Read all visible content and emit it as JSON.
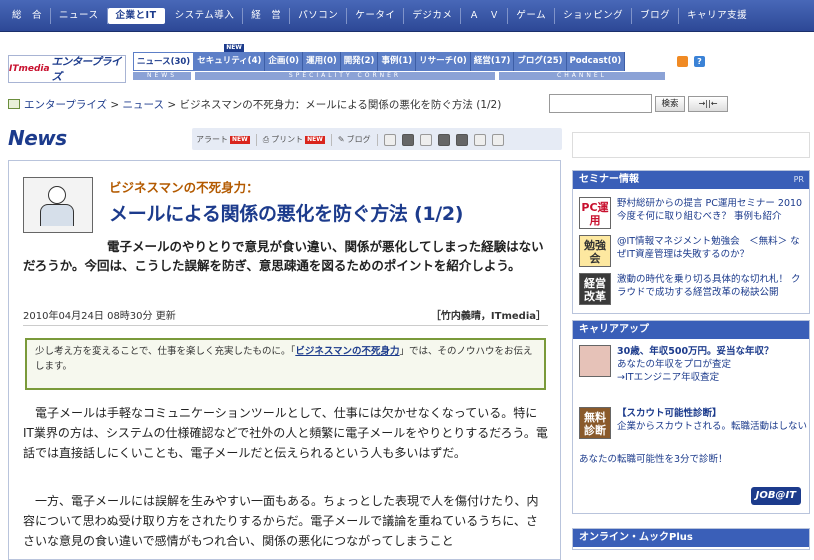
{
  "topnav": {
    "items": [
      "総　合",
      "ニュース",
      "企業とIT",
      "システム導入",
      "経　営",
      "パソコン",
      "ケータイ",
      "デジカメ",
      "Ａ　Ｖ",
      "ゲーム",
      "ショッピング",
      "ブログ",
      "キャリア支援"
    ],
    "active_index": 2
  },
  "logo": {
    "brand": "ITmedia",
    "name": "エンタープライズ"
  },
  "channels": {
    "tabs": [
      "ニュース(30)",
      "セキュリティ(4)",
      "企画(0)",
      "運用(0)",
      "開発(2)",
      "事例(1)",
      "リサーチ(0)",
      "経営(17)",
      "ブログ(25)",
      "Podcast(0)"
    ],
    "new_badge": "NEW",
    "news_label": "NEWS",
    "speciality_label": "SPECIALITY CORNER",
    "channel_label": "CHANNEL"
  },
  "breadcrumb": {
    "items": [
      "エンタープライズ",
      "ニュース"
    ],
    "current": "ビジネスマンの不死身力：メールによる関係の悪化を防ぐ方法 (1/2)",
    "sep": " > "
  },
  "search": {
    "button": "検索",
    "scope": "→||←"
  },
  "section": {
    "title": "News"
  },
  "toolbar": {
    "alert": "アラート",
    "print": "プリント",
    "blog": "ブログ",
    "new": "NEW"
  },
  "article": {
    "kicker": "ビジネスマンの不死身力：",
    "title": "メールによる関係の悪化を防ぐ方法 (1/2)",
    "lead": "電子メールのやりとりで意見が食い違い、関係が悪化してしまった経験はないだろうか。今回は、こうした誤解を防ぎ、意思疎通を図るためのポイントを紹介しよう。",
    "date": "2010年04月24日 08時30分 更新",
    "byline": "［竹内義晴，ITmedia］",
    "note_pre": "少し考え方を変えることで、仕事を楽しく充実したものに。「",
    "note_link": "ビジネスマンの不死身力",
    "note_post": "」では、そのノウハウをお伝えします。",
    "p1": "電子メールは手軽なコミュニケーションツールとして、仕事には欠かせなくなっている。特にIT業界の方は、システムの仕様確認などで社外の人と頻繁に電子メールをやりとりするだろう。電話では直接話しにくいことも、電子メールだと伝えられるという人も多いはずだ。",
    "p2": "一方、電子メールには誤解を生みやすい一面もある。ちょっとした表現で人を傷付けたり、内容について思わぬ受け取り方をされたりするからだ。電子メールで議論を重ねているうちに、ささいな意見の食い違いで感情がもつれ合い、関係の悪化につながってしまうこと"
  },
  "sidebar": {
    "seminar": {
      "title": "セミナー情報",
      "pr": "PR",
      "items": [
        {
          "icon": "PC運用",
          "text": "野村総研からの提言 PC運用セミナー 2010 今度そ何に取り組むべき？ 事例も紹介"
        },
        {
          "icon": "勉強会",
          "text": "@IT情報マネジメント勉強会　＜無料＞ なぜIT資産管理は失敗するのか？"
        },
        {
          "icon": "経営改革",
          "text": "激動の時代を乗り切る具体的な切れ札！ クラウドで成功する経営改革の秘訣公開"
        }
      ]
    },
    "career": {
      "title": "キャリアアップ",
      "item1": {
        "headline": "30歳、年収500万円。妥当な年収？",
        "line2": "あなたの年収をプロが査定",
        "line3": "→ITエンジニア年収査定"
      },
      "item2": {
        "icon": "無料診断",
        "headline": "【スカウト可能性診断】",
        "line2": "企業からスカウトされる。転職活動はしない",
        "line3": "あなたの転職可能性を3分で診断！"
      },
      "job_logo": "JOB@IT"
    },
    "online": {
      "title": "オンライン・ムックPlus"
    }
  }
}
